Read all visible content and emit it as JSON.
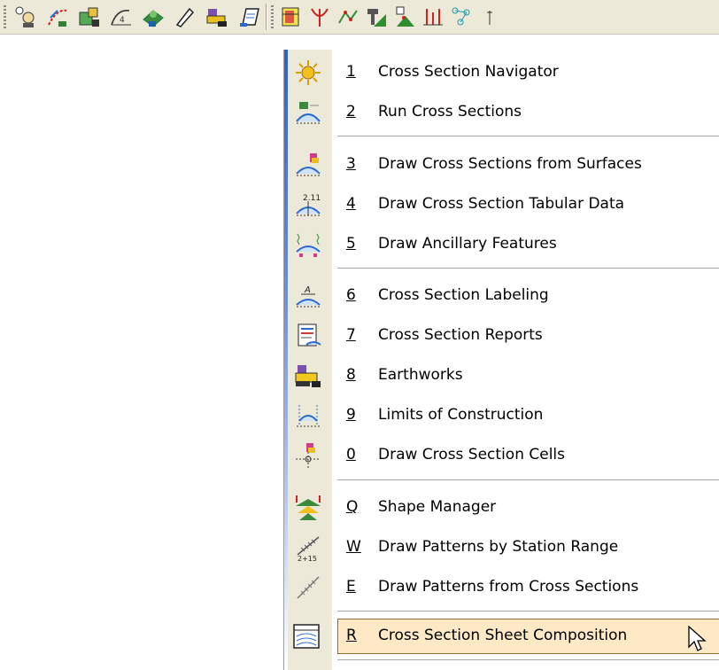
{
  "toolbar": {
    "icons_group1": [
      "survey-icon",
      "alignment-icon",
      "roadway-icon",
      "profile-icon",
      "surface-icon",
      "pen-icon",
      "earthworks-icon",
      "notes-icon"
    ],
    "icons_group2": [
      "table-icon",
      "interchange-icon",
      "figure-icon",
      "pin-icon",
      "grid-icon",
      "elevation-icon",
      "network-icon"
    ]
  },
  "menu": {
    "items": [
      {
        "key": "1",
        "label": "Cross Section Navigator",
        "icon": "navigator-icon"
      },
      {
        "key": "2",
        "label": "Run Cross Sections",
        "icon": "run-cross-sections-icon"
      },
      {
        "key": "3",
        "label": "Draw Cross Sections from Surfaces",
        "icon": "draw-from-surfaces-icon"
      },
      {
        "key": "4",
        "label": "Draw Cross Section Tabular Data",
        "icon": "tabular-data-icon"
      },
      {
        "key": "5",
        "label": "Draw Ancillary Features",
        "icon": "ancillary-features-icon"
      },
      {
        "key": "6",
        "label": "Cross Section Labeling",
        "icon": "labeling-icon"
      },
      {
        "key": "7",
        "label": "Cross Section Reports",
        "icon": "reports-icon"
      },
      {
        "key": "8",
        "label": "Earthworks",
        "icon": "earthworks-icon"
      },
      {
        "key": "9",
        "label": "Limits of Construction",
        "icon": "limits-icon"
      },
      {
        "key": "0",
        "label": "Draw Cross Section Cells",
        "icon": "cells-icon"
      },
      {
        "key": "Q",
        "label": "Shape Manager",
        "icon": "shape-manager-icon"
      },
      {
        "key": "W",
        "label": "Draw Patterns by Station Range",
        "icon": "patterns-station-icon"
      },
      {
        "key": "E",
        "label": "Draw Patterns from Cross Sections",
        "icon": "patterns-cross-icon"
      },
      {
        "key": "R",
        "label": "Cross Section Sheet Composition",
        "icon": "sheet-composition-icon"
      }
    ],
    "highlighted_index": 13,
    "colors": {
      "highlight_bg": "#fde9c6",
      "highlight_border": "#9c6a2a"
    }
  }
}
